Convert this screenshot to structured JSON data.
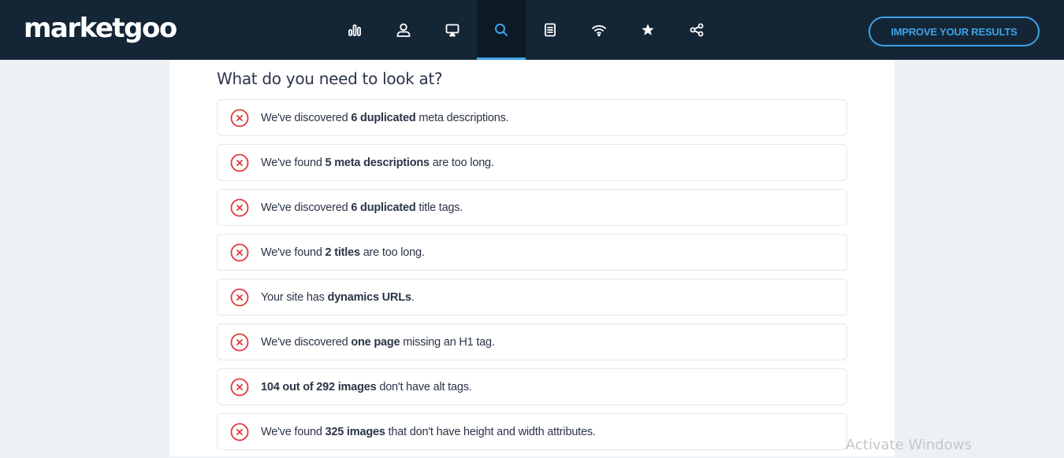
{
  "header": {
    "logo": "marketgoo",
    "cta_label": "IMPROVE YOUR RESULTS",
    "nav": [
      {
        "icon": "bar-chart-icon",
        "active": false
      },
      {
        "icon": "user-icon",
        "active": false
      },
      {
        "icon": "monitor-icon",
        "active": false
      },
      {
        "icon": "search-icon",
        "active": true
      },
      {
        "icon": "document-icon",
        "active": false
      },
      {
        "icon": "wifi-icon",
        "active": false
      },
      {
        "icon": "star-icon",
        "active": false
      },
      {
        "icon": "share-icon",
        "active": false
      }
    ]
  },
  "main": {
    "title": "What do you need to look at?",
    "issues": [
      {
        "pre": "We've discovered ",
        "bold": "6 duplicated",
        "post": " meta descriptions."
      },
      {
        "pre": "We've found ",
        "bold": "5 meta descriptions",
        "post": " are too long."
      },
      {
        "pre": "We've discovered ",
        "bold": "6 duplicated",
        "post": " title tags."
      },
      {
        "pre": "We've found ",
        "bold": "2 titles",
        "post": " are too long."
      },
      {
        "pre": "Your site has ",
        "bold": "dynamics URLs",
        "post": "."
      },
      {
        "pre": "We've discovered ",
        "bold": "one page",
        "post": " missing an H1 tag."
      },
      {
        "pre": "",
        "bold": "104 out of 292 images",
        "post": " don't have alt tags."
      },
      {
        "pre": "We've found ",
        "bold": "325 images",
        "post": " that don't have height and width attributes."
      }
    ]
  },
  "watermark": "Activate Windows",
  "colors": {
    "topbar": "#142636",
    "accent": "#3fa2e8",
    "error": "#e0393e",
    "text": "#2b3547"
  }
}
